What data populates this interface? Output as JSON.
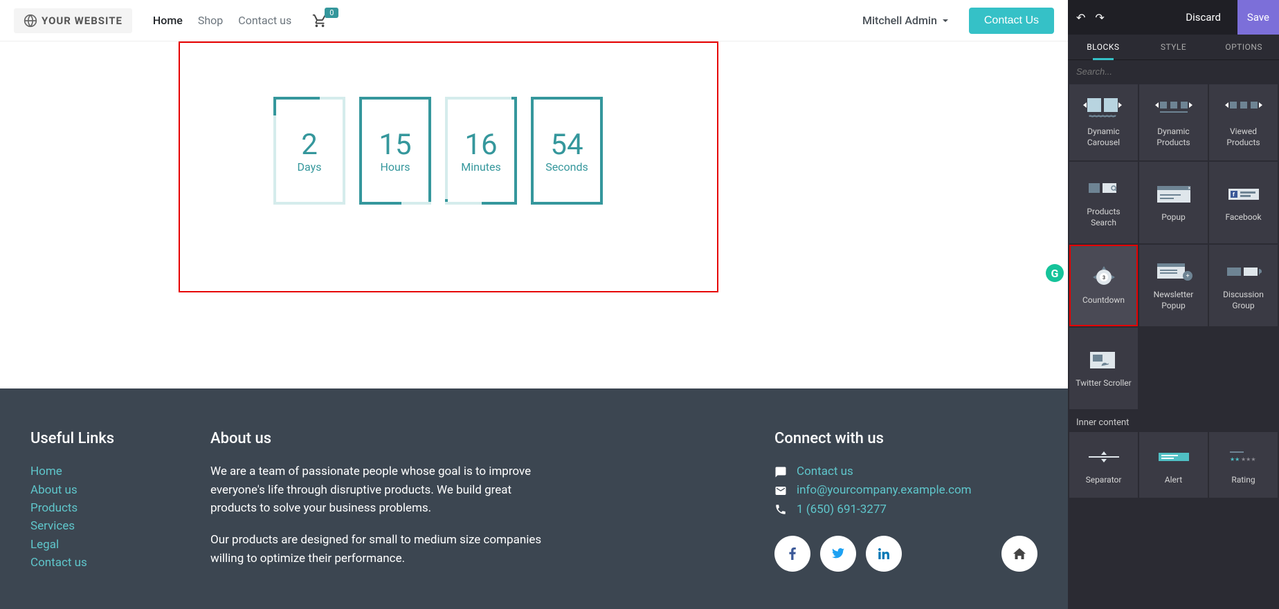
{
  "header": {
    "logo_text": "YOUR WEBSITE",
    "nav": {
      "home": "Home",
      "shop": "Shop",
      "contact": "Contact us"
    },
    "cart_count": "0",
    "user_name": "Mitchell Admin",
    "contact_btn": "Contact Us"
  },
  "countdown": {
    "d_val": "2",
    "d_label": "Days",
    "h_val": "15",
    "h_label": "Hours",
    "m_val": "16",
    "m_label": "Minutes",
    "s_val": "54",
    "s_label": "Seconds"
  },
  "footer": {
    "useful_title": "Useful Links",
    "links": {
      "home": "Home",
      "about": "About us",
      "products": "Products",
      "services": "Services",
      "legal": "Legal",
      "contact": "Contact us"
    },
    "about_title": "About us",
    "about_p1": "We are a team of passionate people whose goal is to improve everyone's life through disruptive products. We build great products to solve your business problems.",
    "about_p2": "Our products are designed for small to medium size companies willing to optimize their performance.",
    "connect_title": "Connect with us",
    "contact_link": "Contact us",
    "email": "info@yourcompany.example.com",
    "phone": "1 (650) 691-3277"
  },
  "editor": {
    "discard": "Discard",
    "save": "Save",
    "tabs": {
      "blocks": "BLOCKS",
      "style": "STYLE",
      "options": "OPTIONS"
    },
    "search_placeholder": "Search...",
    "blocks": {
      "dynamic_carousel": "Dynamic Carousel",
      "dynamic_products": "Dynamic Products",
      "viewed_products": "Viewed Products",
      "products_search": "Products Search",
      "popup": "Popup",
      "facebook": "Facebook",
      "countdown": "Countdown",
      "newsletter_popup": "Newsletter Popup",
      "discussion_group": "Discussion Group",
      "twitter_scroller": "Twitter Scroller",
      "section_inner": "Inner content",
      "separator": "Separator",
      "alert": "Alert",
      "rating": "Rating"
    }
  }
}
